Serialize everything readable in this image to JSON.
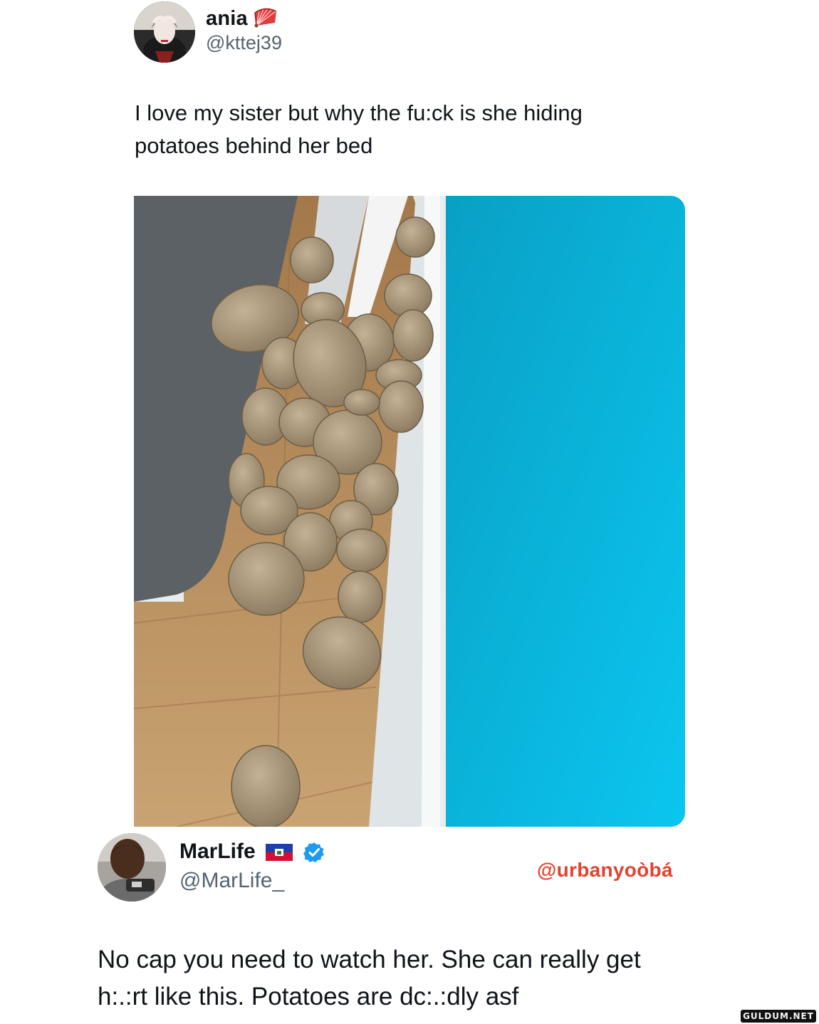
{
  "tweet1": {
    "display_name": "ania",
    "name_emoji_icon": "folding-fan-icon",
    "handle": "@kttej39",
    "text_line1": "I love my sister but why the fu:ck is she hiding",
    "text_line2": "potatoes behind her bed",
    "media": {
      "description_icon": "photo-potatoes-behind-bed",
      "accent_colors": {
        "wall": "#08b9e0",
        "floor": "#b98e5a",
        "bed_frame": "#5c6166",
        "potato": "#a8977c"
      }
    }
  },
  "tweet2": {
    "display_name": "MarLife",
    "flag_icon": "haiti-flag-icon",
    "verified_icon": "verified-badge-icon",
    "verified_color": "#1d9bf0",
    "handle": "@MarLife_",
    "text_line1": "No cap you need to watch her. She can really get",
    "text_line2": "h:.:rt like this. Potatoes are dc:.:dly asf"
  },
  "watermark": {
    "text": "@urbanyoòbá",
    "color": "#e0442f"
  },
  "site_badge": {
    "text": "GULDUM.NET"
  }
}
